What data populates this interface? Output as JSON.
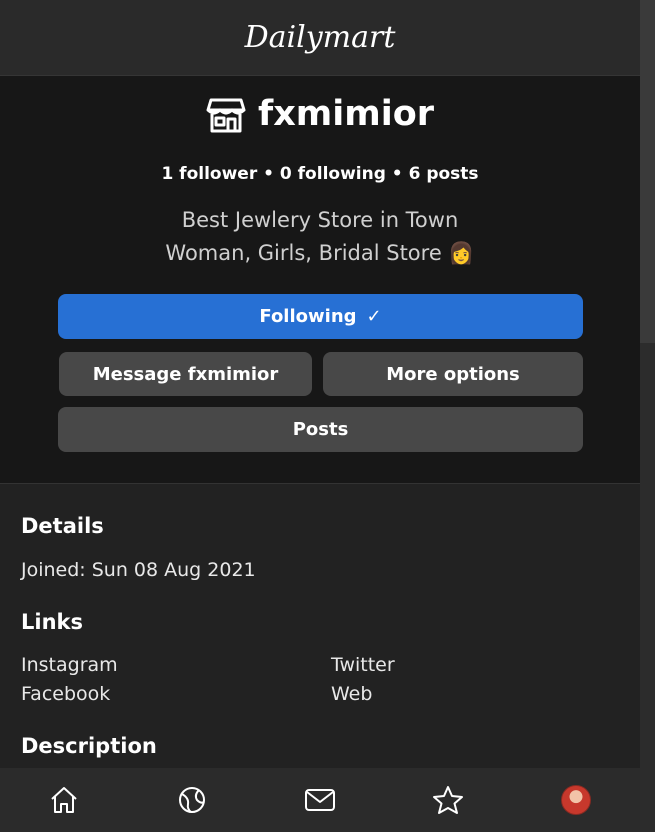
{
  "header": {
    "logo": "Dailymart"
  },
  "profile": {
    "store_icon": "storefront-icon",
    "name": "fxmimior",
    "stats": "1 follower • 0 following • 6 posts",
    "bio_line1": "Best Jewlery Store in Town",
    "bio_line2": "Woman, Girls, Bridal Store 👩",
    "following_label": "Following",
    "following_check": "✓",
    "message_label": "Message fxmimior",
    "more_options_label": "More options",
    "posts_label": "Posts"
  },
  "details": {
    "title": "Details",
    "joined": "Joined: Sun 08 Aug 2021",
    "links_title": "Links",
    "links": [
      "Instagram",
      "Twitter",
      "Facebook",
      "Web"
    ],
    "description_title": "Description"
  },
  "bottom_nav": {
    "items": [
      "home-icon",
      "globe-icon",
      "mail-icon",
      "star-icon",
      "avatar"
    ]
  },
  "colors": {
    "accent": "#2770d4",
    "button_gray": "#484848",
    "profile_bg": "#171717",
    "page_bg": "#222222"
  }
}
